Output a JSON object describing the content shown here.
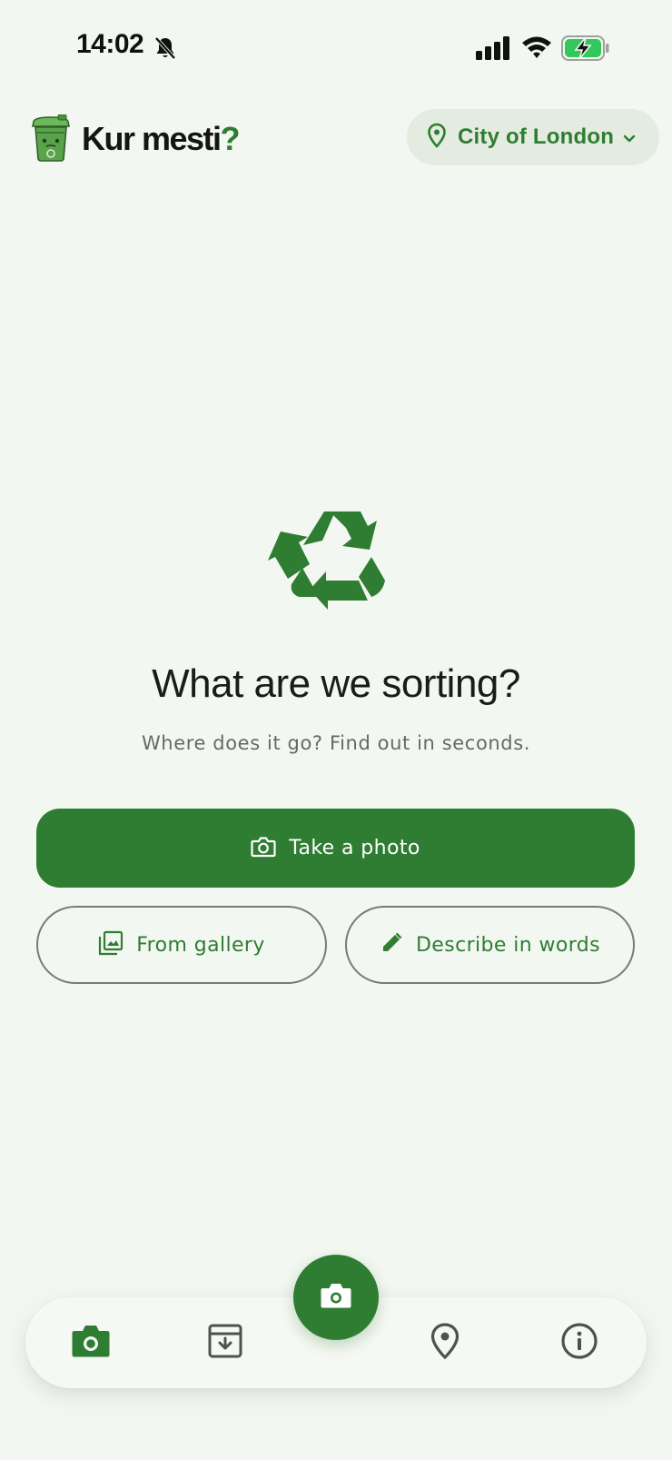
{
  "status_bar": {
    "time": "14:02"
  },
  "header": {
    "app_name": "Kur mesti",
    "app_name_suffix": "?",
    "location": "City of London"
  },
  "hero": {
    "title": "What are we sorting?",
    "subtitle": "Where does it go? Find out in seconds."
  },
  "actions": {
    "take_photo": "Take a photo",
    "from_gallery": "From gallery",
    "describe": "Describe in words"
  },
  "nav": {
    "items": [
      {
        "name": "camera",
        "active": true
      },
      {
        "name": "archive",
        "active": false
      },
      {
        "name": "map",
        "active": false
      },
      {
        "name": "info",
        "active": false
      }
    ]
  },
  "colors": {
    "accent": "#2e7d32",
    "background": "#f3f7f1",
    "pill_background": "#e4ebe1",
    "inactive_icon": "#4d524d"
  }
}
